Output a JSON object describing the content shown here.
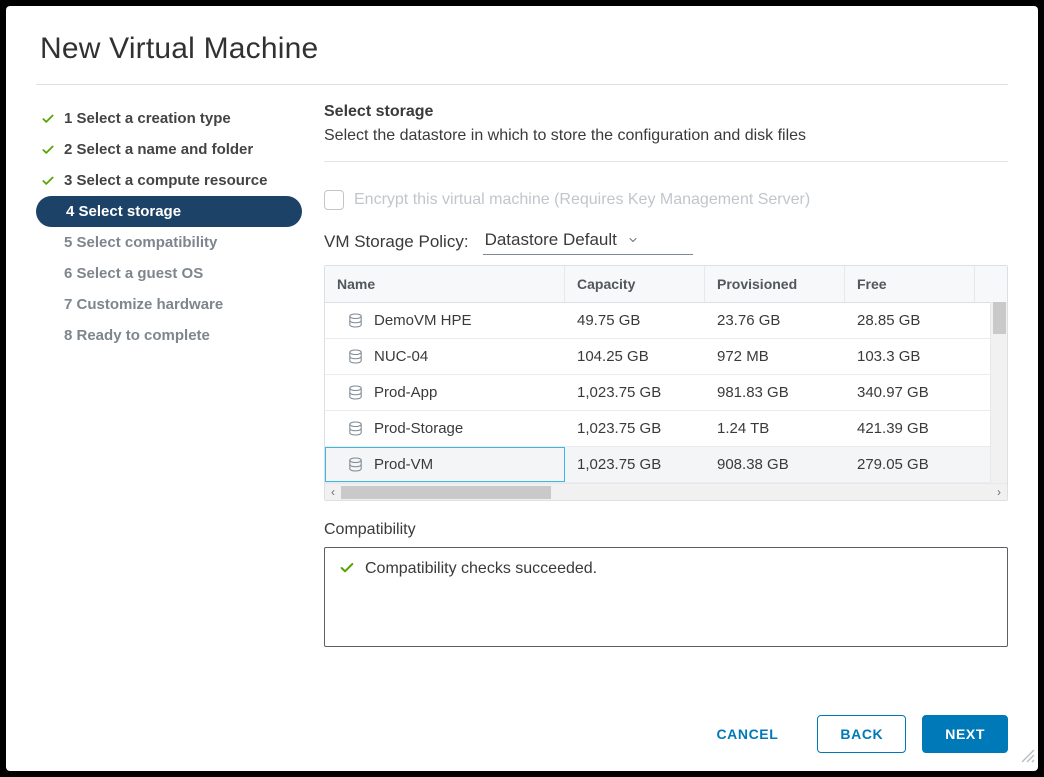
{
  "dialog_title": "New Virtual Machine",
  "steps": [
    {
      "label": "1 Select a creation type",
      "state": "done"
    },
    {
      "label": "2 Select a name and folder",
      "state": "done"
    },
    {
      "label": "3 Select a compute resource",
      "state": "done"
    },
    {
      "label": "4 Select storage",
      "state": "active"
    },
    {
      "label": "5 Select compatibility",
      "state": "future"
    },
    {
      "label": "6 Select a guest OS",
      "state": "future"
    },
    {
      "label": "7 Customize hardware",
      "state": "future"
    },
    {
      "label": "8 Ready to complete",
      "state": "future"
    }
  ],
  "section": {
    "title": "Select storage",
    "subtitle": "Select the datastore in which to store the configuration and disk files"
  },
  "encrypt_label": "Encrypt this virtual machine (Requires Key Management Server)",
  "policy_label": "VM Storage Policy:",
  "policy_value": "Datastore Default",
  "table": {
    "headers": {
      "name": "Name",
      "capacity": "Capacity",
      "provisioned": "Provisioned",
      "free": "Free"
    },
    "rows": [
      {
        "name": "DemoVM HPE",
        "capacity": "49.75 GB",
        "provisioned": "23.76 GB",
        "free": "28.85 GB",
        "selected": false
      },
      {
        "name": "NUC-04",
        "capacity": "104.25 GB",
        "provisioned": "972 MB",
        "free": "103.3 GB",
        "selected": false
      },
      {
        "name": "Prod-App",
        "capacity": "1,023.75 GB",
        "provisioned": "981.83 GB",
        "free": "340.97 GB",
        "selected": false
      },
      {
        "name": "Prod-Storage",
        "capacity": "1,023.75 GB",
        "provisioned": "1.24 TB",
        "free": "421.39 GB",
        "selected": false
      },
      {
        "name": "Prod-VM",
        "capacity": "1,023.75 GB",
        "provisioned": "908.38 GB",
        "free": "279.05 GB",
        "selected": true
      }
    ]
  },
  "compatibility": {
    "label": "Compatibility",
    "message": "Compatibility checks succeeded."
  },
  "buttons": {
    "cancel": "CANCEL",
    "back": "BACK",
    "next": "NEXT"
  }
}
